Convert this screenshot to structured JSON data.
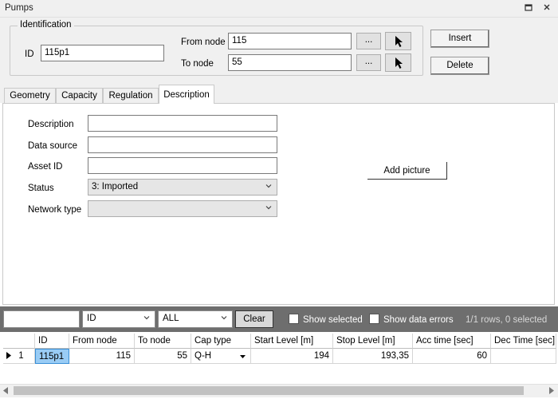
{
  "window": {
    "title": "Pumps"
  },
  "identification": {
    "legend": "Identification",
    "id_label": "ID",
    "id_value": "115p1",
    "from_node_label": "From node",
    "from_node_value": "115",
    "to_node_label": "To node",
    "to_node_value": "55",
    "browse_label": "..."
  },
  "actions": {
    "insert": "Insert",
    "delete": "Delete"
  },
  "tabs": [
    {
      "label": "Geometry"
    },
    {
      "label": "Capacity"
    },
    {
      "label": "Regulation"
    },
    {
      "label": "Description"
    }
  ],
  "description_tab": {
    "description_label": "Description",
    "description_value": "",
    "data_source_label": "Data source",
    "data_source_value": "",
    "asset_id_label": "Asset ID",
    "asset_id_value": "",
    "status_label": "Status",
    "status_value": "3: Imported",
    "network_type_label": "Network type",
    "network_type_value": "",
    "add_picture": "Add picture"
  },
  "filter": {
    "search_value": "",
    "column_value": "ID",
    "scope_value": "ALL",
    "clear": "Clear",
    "show_selected": "Show selected",
    "show_errors": "Show data errors",
    "status": "1/1 rows, 0 selected"
  },
  "grid": {
    "columns": [
      "ID",
      "From node",
      "To node",
      "Cap type",
      "Start Level [m]",
      "Stop Level [m]",
      "Acc time [sec]",
      "Dec Time [sec]"
    ],
    "rows": [
      {
        "num": "1",
        "id": "115p1",
        "from": "115",
        "to": "55",
        "cap": "Q-H",
        "start": "194",
        "stop": "193,35",
        "acc": "60",
        "dec": ""
      }
    ]
  }
}
